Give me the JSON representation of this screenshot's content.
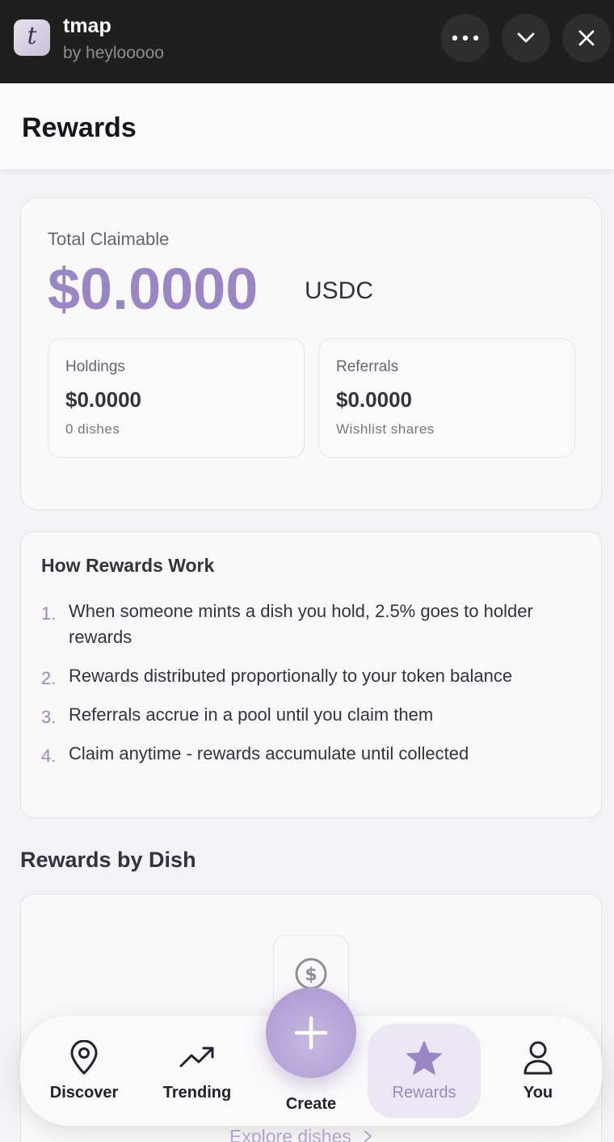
{
  "app": {
    "name": "tmap",
    "by": "by heylooooo",
    "icon_letter": "t"
  },
  "header": {
    "title": "Rewards"
  },
  "claimable": {
    "label": "Total Claimable",
    "amount": "$0.0000",
    "unit": "USDC",
    "holdings": {
      "title": "Holdings",
      "value": "$0.0000",
      "note": "0 dishes"
    },
    "referrals": {
      "title": "Referrals",
      "value": "$0.0000",
      "note": "Wishlist shares"
    }
  },
  "how": {
    "title": "How Rewards Work",
    "items": [
      {
        "num": "1.",
        "text": "When someone mints a dish you hold, 2.5% goes to holder rewards"
      },
      {
        "num": "2.",
        "text": "Rewards distributed proportionally to your token balance"
      },
      {
        "num": "3.",
        "text": "Referrals accrue in a pool until you claim them"
      },
      {
        "num": "4.",
        "text": "Claim anytime - rewards accumulate until collected"
      }
    ]
  },
  "dishes": {
    "title": "Rewards by Dish",
    "explore": "Explore dishes"
  },
  "nav": {
    "discover": "Discover",
    "trending": "Trending",
    "create": "Create",
    "rewards": "Rewards",
    "you": "You"
  },
  "colors": {
    "accent": "#9a86c4",
    "topbar": "#1f1f1f"
  }
}
